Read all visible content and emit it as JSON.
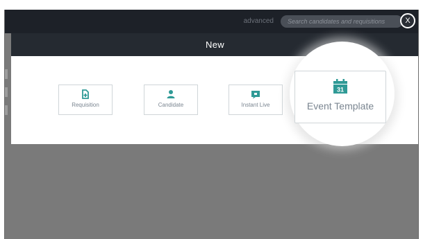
{
  "topbar": {
    "advanced_label": "advanced",
    "search_placeholder": "Search candidates and requisitions",
    "close_label": "X"
  },
  "modal": {
    "title": "New",
    "tiles": [
      {
        "label": "Requisition",
        "icon": "requisition-icon"
      },
      {
        "label": "Candidate",
        "icon": "person-icon"
      },
      {
        "label": "Instant Live",
        "icon": "video-icon"
      }
    ],
    "highlighted_tile": {
      "label": "Event Template",
      "icon": "calendar-icon",
      "icon_day": "31"
    }
  },
  "colors": {
    "accent": "#2f9a96",
    "topbar": "#1d2128",
    "modal_header": "#252a31",
    "overlay": "#7a7a7a"
  }
}
